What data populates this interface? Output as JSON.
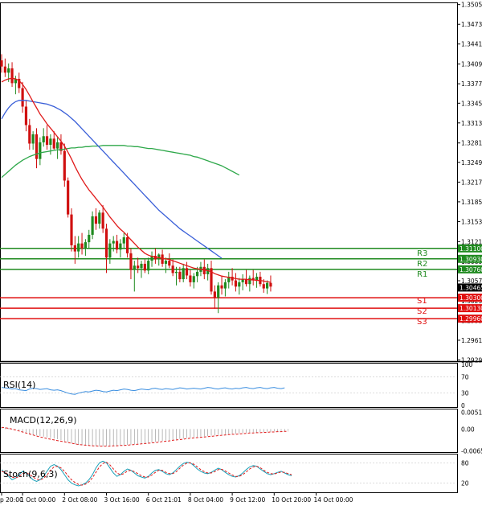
{
  "chart_data": {
    "type": "candlestick",
    "price_axis": {
      "ylim": [
        1.2927,
        1.3509
      ],
      "ticks": [
        "1.35055",
        "1.34735",
        "1.34415",
        "1.34090",
        "1.33770",
        "1.33455",
        "1.33135",
        "1.32810",
        "1.32495",
        "1.32175",
        "1.31855",
        "1.31535",
        "1.31210",
        "1.30890",
        "1.30575",
        "1.30250",
        "1.29930",
        "1.29610",
        "1.29290"
      ]
    },
    "x_axis_labels": [
      {
        "i": 0,
        "label": "p 20:00"
      },
      {
        "i": 6,
        "label": "1 Oct 00:00"
      },
      {
        "i": 18,
        "label": "2 Oct 08:00"
      },
      {
        "i": 30,
        "label": "3 Oct 16:00"
      },
      {
        "i": 42,
        "label": "6 Oct 21:01"
      },
      {
        "i": 54,
        "label": "8 Oct 04:00"
      },
      {
        "i": 66,
        "label": "9 Oct 12:00"
      },
      {
        "i": 78,
        "label": "10 Oct 20:00"
      },
      {
        "i": 90,
        "label": "14 Oct 00:00"
      }
    ],
    "current_price": "1.30465",
    "levels": [
      {
        "name": "R3",
        "value": 1.311,
        "label": "1.31100",
        "color": "#1f8a1f"
      },
      {
        "name": "R2",
        "value": 1.3093,
        "label": "1.30930",
        "color": "#1f8a1f"
      },
      {
        "name": "R1",
        "value": 1.3076,
        "label": "1.30760",
        "color": "#1f8a1f"
      },
      {
        "name": "S1",
        "value": 1.303,
        "label": "1.30300",
        "color": "#e01010"
      },
      {
        "name": "S2",
        "value": 1.3013,
        "label": "1.30130",
        "color": "#e01010"
      },
      {
        "name": "S3",
        "value": 1.2996,
        "label": "1.29960",
        "color": "#e01010"
      }
    ],
    "candles": [
      [
        1.3415,
        1.3425,
        1.3395,
        1.3405
      ],
      [
        1.3405,
        1.3418,
        1.3388,
        1.3395
      ],
      [
        1.3395,
        1.341,
        1.338,
        1.3402
      ],
      [
        1.3402,
        1.3412,
        1.3372,
        1.3378
      ],
      [
        1.3378,
        1.339,
        1.336,
        1.3385
      ],
      [
        1.3385,
        1.3395,
        1.3362,
        1.337
      ],
      [
        1.337,
        1.338,
        1.333,
        1.334
      ],
      [
        1.334,
        1.335,
        1.33,
        1.331
      ],
      [
        1.331,
        1.332,
        1.327,
        1.328
      ],
      [
        1.328,
        1.33,
        1.327,
        1.3295
      ],
      [
        1.3295,
        1.3305,
        1.324,
        1.3255
      ],
      [
        1.3255,
        1.329,
        1.3245,
        1.3282
      ],
      [
        1.3282,
        1.3305,
        1.3275,
        1.3292
      ],
      [
        1.3292,
        1.331,
        1.327,
        1.3278
      ],
      [
        1.3278,
        1.3295,
        1.3262,
        1.3288
      ],
      [
        1.3288,
        1.33,
        1.327,
        1.3272
      ],
      [
        1.3272,
        1.329,
        1.3255,
        1.3282
      ],
      [
        1.3282,
        1.3295,
        1.3262,
        1.3268
      ],
      [
        1.3268,
        1.328,
        1.321,
        1.322
      ],
      [
        1.322,
        1.3225,
        1.316,
        1.3165
      ],
      [
        1.3165,
        1.3175,
        1.3105,
        1.3115
      ],
      [
        1.3115,
        1.313,
        1.3085,
        1.3105
      ],
      [
        1.3105,
        1.313,
        1.3095,
        1.3118
      ],
      [
        1.3118,
        1.3135,
        1.31,
        1.311
      ],
      [
        1.311,
        1.3125,
        1.3098,
        1.312
      ],
      [
        1.312,
        1.314,
        1.311,
        1.3132
      ],
      [
        1.3132,
        1.317,
        1.3125,
        1.3162
      ],
      [
        1.3162,
        1.3175,
        1.314,
        1.315
      ],
      [
        1.315,
        1.3172,
        1.3142,
        1.3168
      ],
      [
        1.3168,
        1.318,
        1.3135,
        1.3142
      ],
      [
        1.3142,
        1.315,
        1.307,
        1.3095
      ],
      [
        1.3095,
        1.3125,
        1.3085,
        1.3118
      ],
      [
        1.3118,
        1.313,
        1.3105,
        1.3122
      ],
      [
        1.3122,
        1.3132,
        1.3102,
        1.3108
      ],
      [
        1.3108,
        1.3125,
        1.3095,
        1.3118
      ],
      [
        1.3118,
        1.3135,
        1.311,
        1.3128
      ],
      [
        1.3128,
        1.3135,
        1.3095,
        1.3102
      ],
      [
        1.3102,
        1.311,
        1.306,
        1.3075
      ],
      [
        1.3075,
        1.309,
        1.304,
        1.3082
      ],
      [
        1.3082,
        1.3095,
        1.307,
        1.3078
      ],
      [
        1.3078,
        1.309,
        1.3062,
        1.3085
      ],
      [
        1.3085,
        1.3092,
        1.307,
        1.3074
      ],
      [
        1.3074,
        1.3095,
        1.3068,
        1.309
      ],
      [
        1.309,
        1.3105,
        1.308,
        1.3098
      ],
      [
        1.3098,
        1.311,
        1.3085,
        1.3092
      ],
      [
        1.3092,
        1.3102,
        1.3082,
        1.31
      ],
      [
        1.31,
        1.3108,
        1.308,
        1.3085
      ],
      [
        1.3085,
        1.3095,
        1.307,
        1.309
      ],
      [
        1.309,
        1.3102,
        1.3078,
        1.3082
      ],
      [
        1.3082,
        1.3092,
        1.3065,
        1.307
      ],
      [
        1.307,
        1.308,
        1.305,
        1.3072
      ],
      [
        1.3072,
        1.308,
        1.3055,
        1.306
      ],
      [
        1.306,
        1.3085,
        1.3055,
        1.3078
      ],
      [
        1.3078,
        1.3088,
        1.306,
        1.3066
      ],
      [
        1.3066,
        1.3075,
        1.3048,
        1.3055
      ],
      [
        1.3055,
        1.307,
        1.3045,
        1.3065
      ],
      [
        1.3065,
        1.308,
        1.3055,
        1.3072
      ],
      [
        1.3072,
        1.3088,
        1.3065,
        1.308
      ],
      [
        1.308,
        1.3092,
        1.306,
        1.3068
      ],
      [
        1.3068,
        1.3085,
        1.3058,
        1.3078
      ],
      [
        1.3078,
        1.309,
        1.3035,
        1.304
      ],
      [
        1.304,
        1.305,
        1.3012,
        1.303
      ],
      [
        1.303,
        1.3055,
        1.3005,
        1.305
      ],
      [
        1.305,
        1.3065,
        1.3035,
        1.3045
      ],
      [
        1.3045,
        1.306,
        1.3032,
        1.3055
      ],
      [
        1.3055,
        1.3072,
        1.3045,
        1.3064
      ],
      [
        1.3064,
        1.3078,
        1.305,
        1.3058
      ],
      [
        1.3058,
        1.307,
        1.304,
        1.3048
      ],
      [
        1.3048,
        1.3062,
        1.3035,
        1.3055
      ],
      [
        1.3055,
        1.3068,
        1.3042,
        1.306
      ],
      [
        1.306,
        1.3075,
        1.3048,
        1.3052
      ],
      [
        1.3052,
        1.3066,
        1.304,
        1.3062
      ],
      [
        1.3062,
        1.3075,
        1.305,
        1.3058
      ],
      [
        1.3058,
        1.307,
        1.3046,
        1.3064
      ],
      [
        1.3064,
        1.3072,
        1.3048,
        1.3052
      ],
      [
        1.3052,
        1.306,
        1.3038,
        1.3045
      ],
      [
        1.3045,
        1.3058,
        1.3036,
        1.3054
      ],
      [
        1.3054,
        1.3066,
        1.304,
        1.3048
      ]
    ],
    "ma_fast": [
      1.338,
      1.3383,
      1.3385,
      1.3386,
      1.3385,
      1.3382,
      1.3376,
      1.3368,
      1.3358,
      1.3348,
      1.3338,
      1.3328,
      1.332,
      1.3312,
      1.3305,
      1.3298,
      1.3291,
      1.3284,
      1.3276,
      1.3266,
      1.3255,
      1.3243,
      1.3232,
      1.3222,
      1.3213,
      1.3205,
      1.3198,
      1.3191,
      1.3184,
      1.3177,
      1.3169,
      1.3161,
      1.3154,
      1.3147,
      1.3141,
      1.3136,
      1.313,
      1.3124,
      1.3118,
      1.3112,
      1.3107,
      1.3102,
      1.3099,
      1.3097,
      1.3096,
      1.3095,
      1.3094,
      1.3093,
      1.3092,
      1.309,
      1.3088,
      1.3086,
      1.3084,
      1.3082,
      1.308,
      1.3078,
      1.3077,
      1.3076,
      1.3075,
      1.3074,
      1.3072,
      1.3069,
      1.3067,
      1.3065,
      1.3064,
      1.3063,
      1.3062,
      1.3061,
      1.306,
      1.306,
      1.306,
      1.3059,
      1.3059,
      1.3058,
      1.3058,
      1.3057,
      1.3056,
      1.3055
    ],
    "ma_mid": [
      1.332,
      1.333,
      1.3338,
      1.3344,
      1.3348,
      1.335,
      1.335,
      1.335,
      1.3349,
      1.3348,
      1.3347,
      1.3346,
      1.3345,
      1.3344,
      1.3342,
      1.334,
      1.3337,
      1.3334,
      1.333,
      1.3326,
      1.3321,
      1.3316,
      1.331,
      1.3304,
      1.3298,
      1.3292,
      1.3286,
      1.328,
      1.3274,
      1.3268,
      1.3262,
      1.3256,
      1.325,
      1.3244,
      1.3238,
      1.3232,
      1.3226,
      1.322,
      1.3214,
      1.3208,
      1.3202,
      1.3196,
      1.319,
      1.3184,
      1.3178,
      1.3172,
      1.3167,
      1.3162,
      1.3157,
      1.3152,
      1.3147,
      1.3142,
      1.3138,
      1.3134,
      1.313,
      1.3126,
      1.3122,
      1.3118,
      1.3114,
      1.311,
      1.3106,
      1.3102,
      1.3098,
      1.3094
    ],
    "ma_slow": [
      1.3225,
      1.323,
      1.3235,
      1.324,
      1.3245,
      1.3249,
      1.3253,
      1.3256,
      1.3259,
      1.3261,
      1.3263,
      1.3265,
      1.3266,
      1.3267,
      1.3268,
      1.3269,
      1.327,
      1.327,
      1.3271,
      1.3272,
      1.3273,
      1.3273,
      1.3274,
      1.3274,
      1.3275,
      1.3275,
      1.3276,
      1.3276,
      1.3276,
      1.3277,
      1.3277,
      1.3277,
      1.3277,
      1.3277,
      1.3277,
      1.3277,
      1.3276,
      1.3276,
      1.3275,
      1.3275,
      1.3274,
      1.3273,
      1.3272,
      1.3272,
      1.3271,
      1.327,
      1.3269,
      1.3268,
      1.3267,
      1.3266,
      1.3265,
      1.3264,
      1.3263,
      1.3262,
      1.3261,
      1.3259,
      1.3258,
      1.3256,
      1.3254,
      1.3252,
      1.325,
      1.3248,
      1.3246,
      1.3244,
      1.3241,
      1.3238,
      1.3235,
      1.3232,
      1.3229
    ],
    "rsi": {
      "label": "RSI(14)",
      "ylim": [
        0,
        100
      ],
      "ticks": [
        "100",
        "70",
        "30",
        "0"
      ],
      "values": [
        44,
        43,
        42,
        40,
        41,
        38,
        37,
        36,
        40,
        42,
        41,
        39,
        40,
        41,
        38,
        37,
        38,
        36,
        33,
        30,
        28,
        27,
        30,
        32,
        34,
        33,
        35,
        37,
        36,
        34,
        33,
        35,
        37,
        36,
        38,
        40,
        39,
        37,
        36,
        38,
        40,
        39,
        38,
        41,
        42,
        40,
        39,
        41,
        40,
        39,
        41,
        43,
        42,
        40,
        41,
        42,
        41,
        40,
        42,
        44,
        43,
        41,
        40,
        42,
        43,
        41,
        40,
        42,
        41,
        43,
        44,
        42,
        41,
        43,
        44,
        42,
        41,
        43,
        44,
        42,
        41,
        43
      ]
    },
    "macd": {
      "label": "MACD(12,26,9)",
      "ylim": [
        -0.007,
        0.0062
      ],
      "ticks": [
        "0.00515",
        "0.00",
        "-0.00658"
      ],
      "histogram": [
        0.0006,
        0.0005,
        0.0003,
        0.0001,
        -0.0001,
        -0.0004,
        -0.0008,
        -0.0011,
        -0.0014,
        -0.0017,
        -0.0019,
        -0.0021,
        -0.0023,
        -0.0025,
        -0.0027,
        -0.0029,
        -0.0031,
        -0.0034,
        -0.0037,
        -0.004,
        -0.0043,
        -0.0046,
        -0.0048,
        -0.0049,
        -0.005,
        -0.0051,
        -0.0051,
        -0.0052,
        -0.0052,
        -0.0052,
        -0.0052,
        -0.0051,
        -0.0051,
        -0.005,
        -0.005,
        -0.0049,
        -0.0048,
        -0.0047,
        -0.0046,
        -0.0045,
        -0.0044,
        -0.0043,
        -0.0042,
        -0.0041,
        -0.0039,
        -0.0038,
        -0.0036,
        -0.0035,
        -0.0034,
        -0.0032,
        -0.0031,
        -0.003,
        -0.0029,
        -0.0027,
        -0.0026,
        -0.0025,
        -0.0024,
        -0.0023,
        -0.0022,
        -0.0021,
        -0.002,
        -0.0019,
        -0.0018,
        -0.0017,
        -0.0016,
        -0.0015,
        -0.0014,
        -0.0014,
        -0.0013,
        -0.0012,
        -0.0011,
        -0.0011,
        -0.001,
        -0.001,
        -0.0009,
        -0.0009,
        -0.0008,
        -0.0008,
        -0.0007,
        -0.0007,
        -0.0006,
        -0.0006,
        -0.0005
      ],
      "signal": [
        0.0005,
        0.0004,
        0.0002,
        0.0,
        -0.0003,
        -0.0006,
        -0.0009,
        -0.0012,
        -0.0015,
        -0.0018,
        -0.0021,
        -0.0024,
        -0.0026,
        -0.0029,
        -0.0031,
        -0.0033,
        -0.0035,
        -0.0037,
        -0.0039,
        -0.0041,
        -0.0043,
        -0.0045,
        -0.0047,
        -0.0048,
        -0.0049,
        -0.005,
        -0.0051,
        -0.0051,
        -0.0052,
        -0.0052,
        -0.0052,
        -0.0052,
        -0.0051,
        -0.0051,
        -0.005,
        -0.005,
        -0.0049,
        -0.0048,
        -0.0047,
        -0.0046,
        -0.0045,
        -0.0044,
        -0.0043,
        -0.0042,
        -0.0041,
        -0.004,
        -0.0038,
        -0.0037,
        -0.0036,
        -0.0034,
        -0.0033,
        -0.0032,
        -0.0031,
        -0.0029,
        -0.0028,
        -0.0027,
        -0.0026,
        -0.0025,
        -0.0024,
        -0.0023,
        -0.0022,
        -0.0021,
        -0.002,
        -0.0019,
        -0.0018,
        -0.0017,
        -0.0016,
        -0.0016,
        -0.0015,
        -0.0014,
        -0.0013,
        -0.0012,
        -0.0012,
        -0.0011,
        -0.0011,
        -0.001,
        -0.001,
        -0.0009,
        -0.0009,
        -0.0008,
        -0.0008,
        -0.0007,
        -0.0007
      ]
    },
    "stoch": {
      "label": "Stoch(9,6,3)",
      "ylim": [
        0,
        100
      ],
      "ticks": [
        "80",
        "20"
      ],
      "k": [
        60,
        50,
        40,
        30,
        35,
        45,
        55,
        50,
        40,
        30,
        25,
        30,
        40,
        55,
        70,
        75,
        70,
        60,
        45,
        30,
        20,
        15,
        12,
        15,
        20,
        30,
        45,
        65,
        80,
        85,
        80,
        65,
        50,
        40,
        45,
        55,
        62,
        58,
        50,
        42,
        38,
        35,
        40,
        50,
        58,
        60,
        55,
        48,
        45,
        50,
        60,
        70,
        78,
        82,
        80,
        72,
        62,
        55,
        50,
        48,
        52,
        58,
        64,
        60,
        52,
        45,
        40,
        38,
        42,
        50,
        60,
        68,
        72,
        70,
        62,
        55,
        48,
        45,
        48,
        52,
        55,
        50,
        45,
        42
      ],
      "d": [
        55,
        52,
        45,
        38,
        35,
        40,
        48,
        50,
        46,
        38,
        32,
        30,
        34,
        44,
        58,
        68,
        70,
        65,
        55,
        42,
        30,
        22,
        16,
        14,
        17,
        24,
        36,
        52,
        68,
        78,
        82,
        74,
        62,
        50,
        45,
        48,
        56,
        58,
        54,
        48,
        42,
        38,
        38,
        44,
        52,
        58,
        58,
        52,
        48,
        48,
        54,
        64,
        73,
        79,
        80,
        76,
        68,
        60,
        54,
        50,
        50,
        54,
        60,
        61,
        56,
        50,
        44,
        40,
        40,
        45,
        53,
        62,
        68,
        70,
        66,
        58,
        52,
        48,
        47,
        50,
        53,
        52,
        48,
        45
      ]
    }
  }
}
